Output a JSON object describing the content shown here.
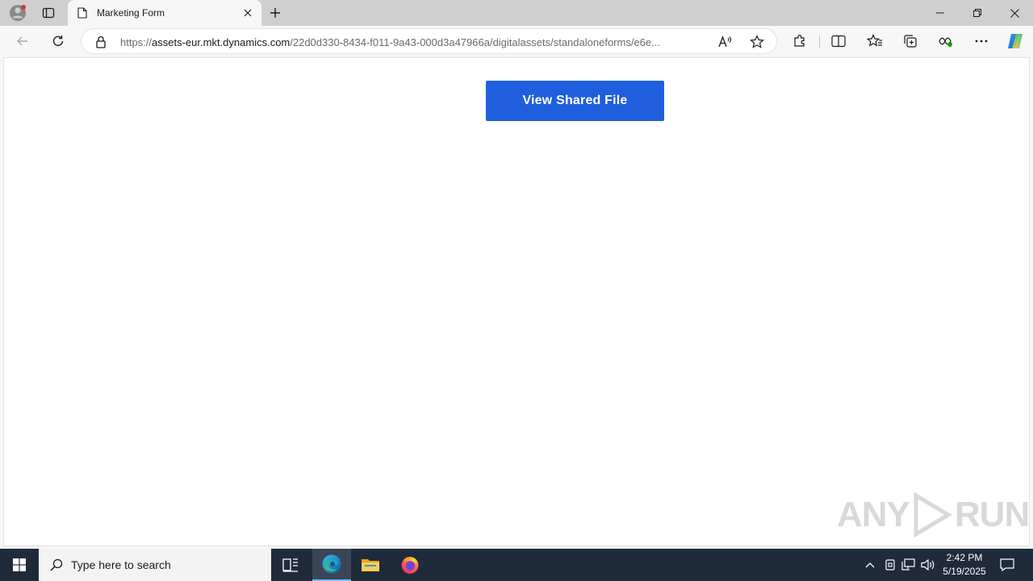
{
  "tab": {
    "title": "Marketing Form"
  },
  "address": {
    "prefix": "https://",
    "host": "assets-eur.mkt.dynamics.com",
    "path": "/22d0d330-8434-f011-9a43-000d3a47966a/digitalassets/standaloneforms/e6e..."
  },
  "page": {
    "button_label": "View Shared File"
  },
  "watermark": {
    "text_left": "ANY",
    "text_right": "RUN"
  },
  "taskbar": {
    "search_placeholder": "Type here to search",
    "time": "2:42 PM",
    "date": "5/19/2025"
  },
  "colors": {
    "accent": "#1f5fde",
    "taskbar": "#1f2b3b"
  }
}
